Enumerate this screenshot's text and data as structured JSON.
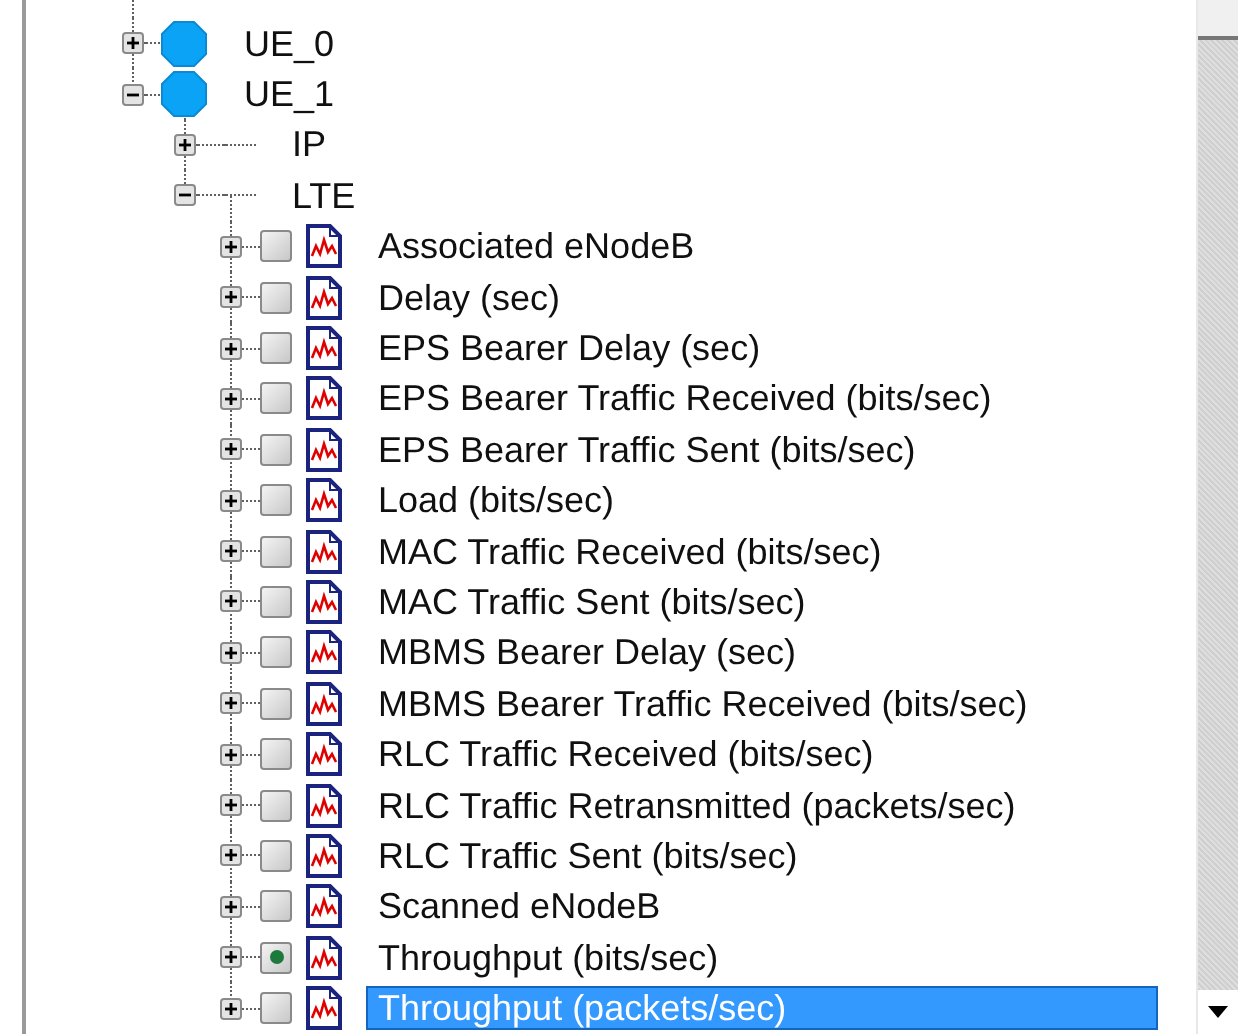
{
  "tree": [
    {
      "kind": "node",
      "label": "UE_0",
      "expanded": false
    },
    {
      "kind": "node",
      "label": "UE_1",
      "expanded": true,
      "children": [
        {
          "kind": "folder",
          "label": "IP",
          "expanded": false
        },
        {
          "kind": "folder",
          "label": "LTE",
          "expanded": true,
          "children": [
            {
              "kind": "statistic",
              "label": "Associated eNodeB",
              "expanded": false,
              "checked": false,
              "selected": false
            },
            {
              "kind": "statistic",
              "label": "Delay (sec)",
              "expanded": false,
              "checked": false,
              "selected": false
            },
            {
              "kind": "statistic",
              "label": "EPS Bearer Delay (sec)",
              "expanded": false,
              "checked": false,
              "selected": false
            },
            {
              "kind": "statistic",
              "label": "EPS Bearer Traffic Received (bits/sec)",
              "expanded": false,
              "checked": false,
              "selected": false
            },
            {
              "kind": "statistic",
              "label": "EPS Bearer Traffic Sent (bits/sec)",
              "expanded": false,
              "checked": false,
              "selected": false
            },
            {
              "kind": "statistic",
              "label": "Load (bits/sec)",
              "expanded": false,
              "checked": false,
              "selected": false
            },
            {
              "kind": "statistic",
              "label": "MAC Traffic Received (bits/sec)",
              "expanded": false,
              "checked": false,
              "selected": false
            },
            {
              "kind": "statistic",
              "label": "MAC Traffic Sent (bits/sec)",
              "expanded": false,
              "checked": false,
              "selected": false
            },
            {
              "kind": "statistic",
              "label": "MBMS Bearer Delay (sec)",
              "expanded": false,
              "checked": false,
              "selected": false
            },
            {
              "kind": "statistic",
              "label": "MBMS Bearer Traffic Received (bits/sec)",
              "expanded": false,
              "checked": false,
              "selected": false
            },
            {
              "kind": "statistic",
              "label": "RLC Traffic Received (bits/sec)",
              "expanded": false,
              "checked": false,
              "selected": false
            },
            {
              "kind": "statistic",
              "label": "RLC Traffic Retransmitted (packets/sec)",
              "expanded": false,
              "checked": false,
              "selected": false
            },
            {
              "kind": "statistic",
              "label": "RLC Traffic Sent (bits/sec)",
              "expanded": false,
              "checked": false,
              "selected": false
            },
            {
              "kind": "statistic",
              "label": "Scanned eNodeB",
              "expanded": false,
              "checked": false,
              "selected": false
            },
            {
              "kind": "statistic",
              "label": "Throughput (bits/sec)",
              "expanded": false,
              "checked": true,
              "selected": false
            },
            {
              "kind": "statistic",
              "label": "Throughput (packets/sec)",
              "expanded": false,
              "checked": false,
              "selected": true
            }
          ]
        }
      ]
    }
  ]
}
